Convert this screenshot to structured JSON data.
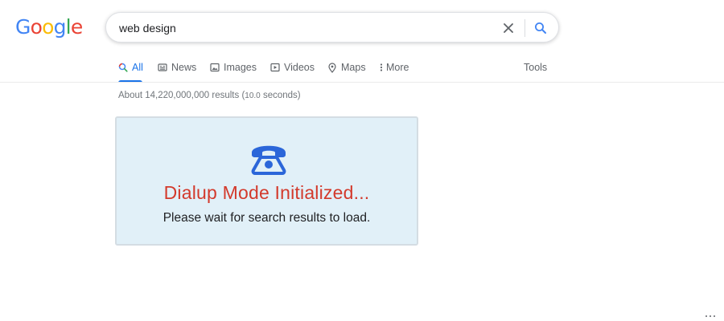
{
  "logo": {
    "letters": [
      "G",
      "o",
      "o",
      "g",
      "l",
      "e"
    ]
  },
  "search": {
    "query": "web design"
  },
  "tabs": [
    {
      "label": "All",
      "icon": "search-icon",
      "active": true
    },
    {
      "label": "News",
      "icon": "news-icon"
    },
    {
      "label": "Images",
      "icon": "images-icon"
    },
    {
      "label": "Videos",
      "icon": "video-icon"
    },
    {
      "label": "Maps",
      "icon": "map-pin-icon"
    },
    {
      "label": "More",
      "icon": "more-vertical-icon"
    }
  ],
  "tools_label": "Tools",
  "stats": {
    "prefix": "About 14,220,000,000 results (",
    "seconds": "10.0",
    "suffix": " seconds)"
  },
  "notice": {
    "icon": "telephone-icon",
    "title": "Dialup Mode Initialized...",
    "message": "Please wait for search results to load."
  },
  "colors": {
    "accent": "#1a73e8",
    "notice_title": "#d33a2c",
    "notice_background": "#e1f0f8",
    "phone_icon": "#2b66d9"
  }
}
